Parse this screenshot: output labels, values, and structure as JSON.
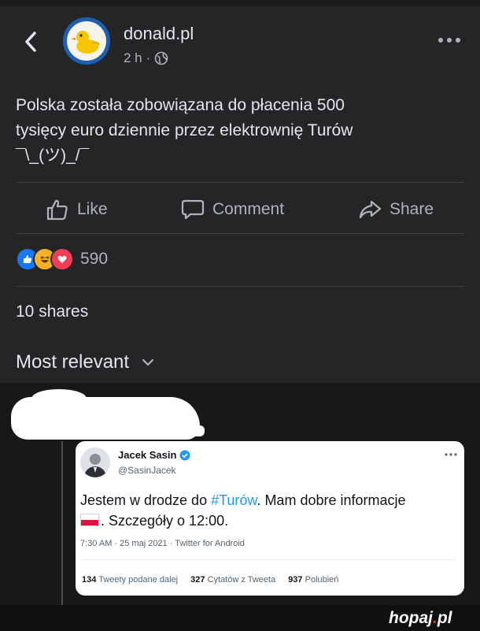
{
  "header": {
    "page_name": "donald.pl",
    "time": "2 h",
    "separator": "·",
    "audience_icon": "globe-icon"
  },
  "post": {
    "text_line1": "Polska została zobowiązana do płacenia 500",
    "text_line2": "tysięcy euro dziennie przez elektrownię Turów",
    "text_line3": "¯\\_(ツ)_/¯"
  },
  "actions": {
    "like": "Like",
    "comment": "Comment",
    "share": "Share"
  },
  "reactions": {
    "icons": [
      "like-reaction-icon",
      "haha-reaction-icon",
      "love-reaction-icon"
    ],
    "count": "590"
  },
  "shares_text": "10 shares",
  "comments_sort": "Most relevant",
  "tweet": {
    "name": "Jacek Sasin",
    "handle": "@SasinJacek",
    "text_before": "Jestem w drodze do ",
    "hashtag": "#Turów",
    "text_after": ". Mam dobre informacje",
    "text_line2": ". Szczegóły o 12:00.",
    "meta": "7:30 AM · 25 maj 2021 · Twitter for Android",
    "retweets_count": "134",
    "retweets_label": "Tweety podane dalej",
    "quotes_count": "327",
    "quotes_label": "Cytatów z Tweeta",
    "likes_count": "937",
    "likes_label": "Polubień"
  },
  "watermark": {
    "brand": "hopaj",
    "dot": ".",
    "tld": "pl"
  },
  "colors": {
    "background": "#242526",
    "text": "#e4e6eb",
    "secondary": "#b0b3b8",
    "link": "#1d9bf0",
    "like": "#1877f2",
    "love": "#f33e58",
    "haha": "#f7b125"
  }
}
